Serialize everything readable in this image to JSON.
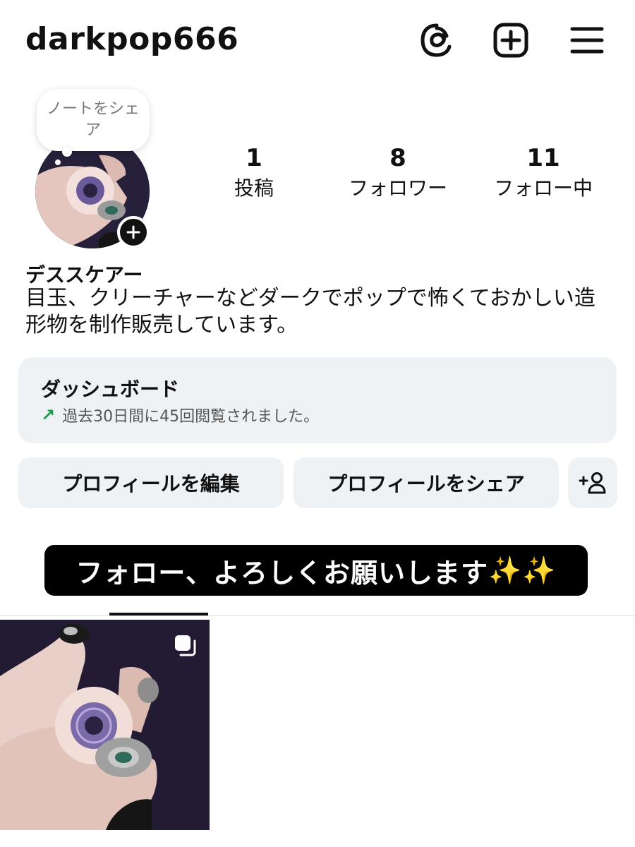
{
  "header": {
    "username": "darkpop666",
    "icons": [
      "threads-icon",
      "create-plus-icon",
      "menu-icon"
    ]
  },
  "note": {
    "text": "ノートをシェア"
  },
  "profile": {
    "display_name": "デススケアー",
    "bio": "目玉、クリーチャーなどダークでポップで怖くておかしい造形物を制作販売しています。"
  },
  "stats": [
    {
      "value": "1",
      "label": "投稿"
    },
    {
      "value": "8",
      "label": "フォロワー"
    },
    {
      "value": "11",
      "label": "フォロー中"
    }
  ],
  "dashboard": {
    "title": "ダッシュボード",
    "subtitle": "過去30日間に45回閲覧されました。",
    "trend_icon": "trend-up-arrow-icon",
    "trend_color": "#1a9b4a"
  },
  "buttons": {
    "edit_profile": "プロフィールを編集",
    "share_profile": "プロフィールをシェア",
    "discover_people_icon": "add-person-icon"
  },
  "caption": {
    "text": "フォロー、よろしくお願いします",
    "emoji": "✨✨"
  },
  "tabs": {
    "active": "grid"
  },
  "posts": [
    {
      "type": "multi-image",
      "icon": "carousel-icon"
    }
  ]
}
